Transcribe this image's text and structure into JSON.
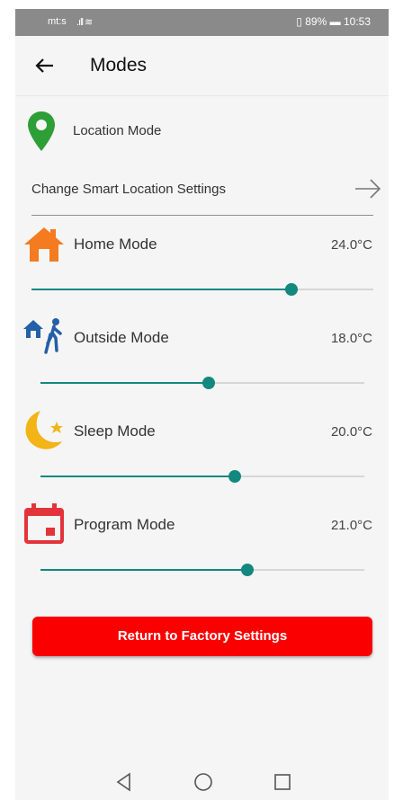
{
  "status_bar": {
    "carrier": "mt:s",
    "battery_percent": "89%",
    "time": "10:53"
  },
  "header": {
    "title": "Modes",
    "back_icon": "arrow-left-icon"
  },
  "location": {
    "label": "Location Mode",
    "icon": "location-pin-icon",
    "icon_color": "#2e9e36",
    "change_label": "Change Smart Location Settings",
    "change_icon": "arrow-right-icon"
  },
  "modes": [
    {
      "label": "Home Mode",
      "temp": "24.0°C",
      "icon": "house-icon",
      "icon_color": "#f47b20",
      "slider_value": 0.76
    },
    {
      "label": "Outside Mode",
      "temp": "18.0°C",
      "icon": "house-person-walking-icon",
      "icon_color": "#2460a7",
      "slider_value": 0.52
    },
    {
      "label": "Sleep Mode",
      "temp": "20.0°C",
      "icon": "moon-star-icon",
      "icon_color": "#f2b416",
      "slider_value": 0.6
    },
    {
      "label": "Program Mode",
      "temp": "21.0°C",
      "icon": "calendar-icon",
      "icon_color": "#e2343a",
      "slider_value": 0.64
    }
  ],
  "actions": {
    "factory_reset_label": "Return to Factory Settings",
    "button_color": "#fa0000"
  },
  "colors": {
    "slider_accent": "#12887f"
  },
  "nav": {
    "back": "nav-back-icon",
    "home": "nav-home-icon",
    "recents": "nav-recents-icon"
  }
}
